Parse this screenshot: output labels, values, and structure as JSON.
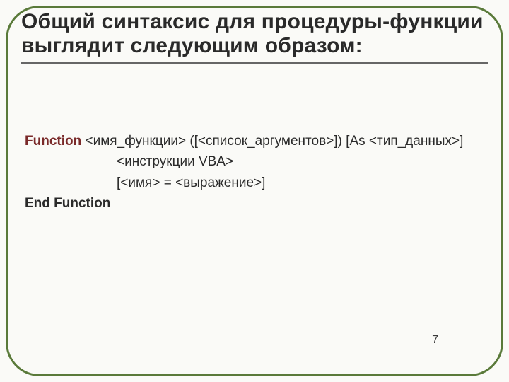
{
  "title": "Общий синтаксис для процедуры-функции выглядит следующим образом:",
  "syntax": {
    "kw_function": "Function",
    "sig_rest": " <имя_функции> ([<список_аргументов>]) [As <тип_данных>]",
    "line2": "<инструкции VBA>",
    "line3": "[<имя> = <выражение>]",
    "kw_end_function": "End Function"
  },
  "page_number": "7"
}
